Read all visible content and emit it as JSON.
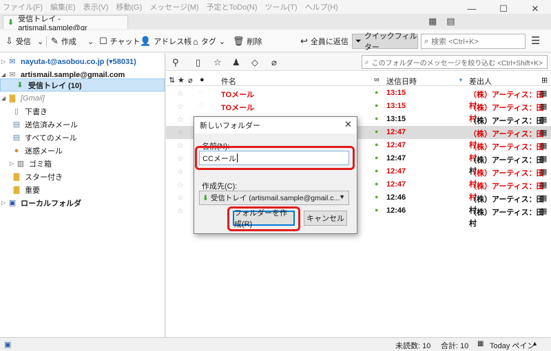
{
  "menubar": {
    "items": [
      "ファイル(F)",
      "編集(E)",
      "表示(V)",
      "移動(G)",
      "メッセージ(M)",
      "予定とToDo(N)",
      "ツール(T)",
      "ヘルプ(H)"
    ]
  },
  "window_controls": [
    "—",
    "☐",
    "✕"
  ],
  "tab": {
    "title": "受信トレイ - artismail.sample@gr"
  },
  "toolbar": {
    "get": "受信",
    "write": "作成",
    "chat": "チャット",
    "addressbook": "アドレス帳",
    "tag": "タグ",
    "delete": "削除",
    "reply_all": "全員に返信",
    "quickfilter": "クイックフィルター",
    "search_placeholder": "検索 <Ctrl+K>"
  },
  "folders": {
    "account1": "nayuta-t@asobou.co.jp (▾58031)",
    "account2": "artismail.sample@gmail.com",
    "inbox": "受信トレイ (10)",
    "gmail": "[Gmail]",
    "drafts": "下書き",
    "sent": "送信済みメール",
    "all": "すべてのメール",
    "spam": "迷惑メール",
    "trash": "ゴミ箱",
    "starred": "スター付き",
    "important": "重要",
    "local": "ローカルフォルダ"
  },
  "quickfilter_search_placeholder": "このフォルダーのメッセージを絞り込む <Ctrl+Shift+K>",
  "columns": {
    "subject": "件名",
    "date": "送信日時",
    "sender": "差出人"
  },
  "messages": [
    {
      "subject": "TOメール",
      "date": "13:15",
      "sender": "（株）アーティス：田村",
      "color": "red"
    },
    {
      "subject": "TOメール",
      "date": "13:15",
      "sender": "（株）アーティス：田村",
      "color": "red"
    },
    {
      "subject": "",
      "date": "13:15",
      "sender": "（株）アーティス：田村",
      "color": "black"
    },
    {
      "subject": "",
      "date": "12:47",
      "sender": "（株）アーティス：田村",
      "color": "red"
    },
    {
      "subject": "",
      "date": "12:47",
      "sender": "（株）アーティス：田村",
      "color": "red"
    },
    {
      "subject": "",
      "date": "12:47",
      "sender": "（株）アーティス：田村",
      "color": "black"
    },
    {
      "subject": "",
      "date": "12:47",
      "sender": "（株）アーティス：田村",
      "color": "red"
    },
    {
      "subject": "",
      "date": "12:47",
      "sender": "（株）アーティス：田村",
      "color": "red"
    },
    {
      "subject": "",
      "date": "12:46",
      "sender": "（株）アーティス：田村",
      "color": "black"
    },
    {
      "subject": "",
      "date": "12:46",
      "sender": "（株）アーティス：田村",
      "color": "black"
    }
  ],
  "statusbar": {
    "unread": "未読数: 10",
    "total": "合計: 10",
    "today": "Today ペイン"
  },
  "dialog": {
    "title": "新しいフォルダー",
    "name_label": "名前(N):",
    "name_value": "CCメール",
    "parent_label": "作成先(C):",
    "parent_value": "受信トレイ (artismail.sample@gmail.c...",
    "create_button": "フォルダーを作成(R)",
    "cancel_button": "キャンセル"
  },
  "colors": {
    "accent": "#0078d7",
    "highlight": "#e21b1b",
    "unread_red": "#e00000",
    "selected_folder": "#cce4f7"
  }
}
